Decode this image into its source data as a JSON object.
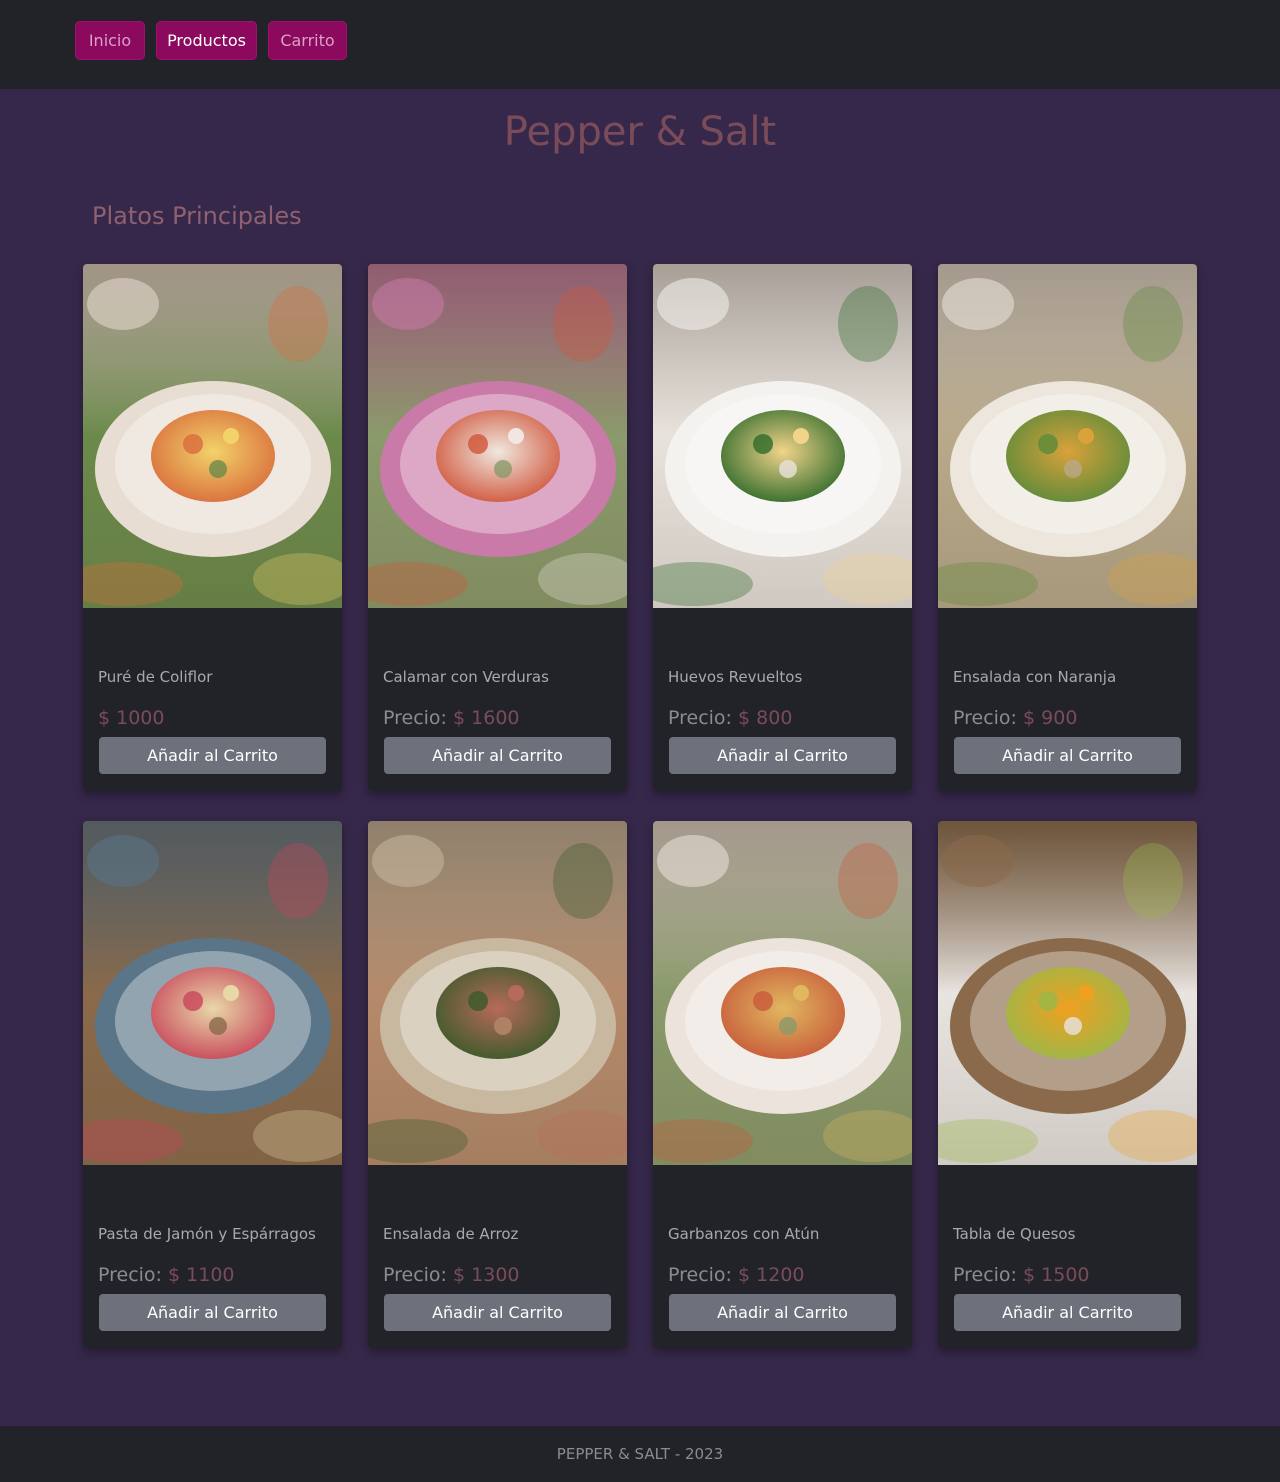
{
  "nav": {
    "items": [
      {
        "label": "Inicio",
        "active": false
      },
      {
        "label": "Productos",
        "active": true
      },
      {
        "label": "Carrito",
        "active": false
      }
    ]
  },
  "site_title": "Pepper & Salt",
  "section_title": "Platos Principales",
  "colors": {
    "nav_button": "#8b0a5e",
    "page_background": "#36284a",
    "card_background": "#212328",
    "price_accent": "#7a4c5a",
    "add_button": "#6c717b"
  },
  "products": [
    {
      "name": "Puré de Coliflor",
      "price_label": "",
      "price": "$ 1000",
      "button": "Añadir al Carrito",
      "image": "cauliflower-puree-photo",
      "palette": [
        "#6b8a4a",
        "#e8ddd2",
        "#f2d36a",
        "#d96c3c"
      ]
    },
    {
      "name": "Calamar con Verduras",
      "price_label": "Precio:",
      "price": "$ 1600",
      "button": "Añadir al Carrito",
      "image": "squid-with-vegetables-photo",
      "palette": [
        "#8a9a6a",
        "#c97aa8",
        "#f0e8e0",
        "#d0553a"
      ]
    },
    {
      "name": "Huevos Revueltos",
      "price_label": "Precio:",
      "price": "$ 800",
      "button": "Añadir al Carrito",
      "image": "scrambled-eggs-asparagus-photo",
      "palette": [
        "#e8e2dc",
        "#f4f2ef",
        "#f1d48a",
        "#2f6a2a"
      ]
    },
    {
      "name": "Ensalada con Naranja",
      "price_label": "Precio:",
      "price": "$ 900",
      "button": "Añadir al Carrito",
      "image": "orange-salad-photo",
      "palette": [
        "#b9a98a",
        "#ece6dc",
        "#d9a23a",
        "#5c8a3a"
      ]
    },
    {
      "name": "Pasta de Jamón y Espárragos",
      "price_label": "Precio:",
      "price": "$ 1100",
      "button": "Añadir al Carrito",
      "image": "ham-asparagus-pasta-photo",
      "palette": [
        "#8a6a4a",
        "#5a7488",
        "#e8d8a8",
        "#c8455a"
      ]
    },
    {
      "name": "Ensalada de Arroz",
      "price_label": "Precio:",
      "price": "$ 1300",
      "button": "Añadir al Carrito",
      "image": "rice-salad-photo",
      "palette": [
        "#b58a6a",
        "#c8b8a0",
        "#b86a5a",
        "#3a5a2a"
      ]
    },
    {
      "name": "Garbanzos con Atún",
      "price_label": "Precio:",
      "price": "$ 1200",
      "button": "Añadir al Carrito",
      "image": "chickpeas-tuna-photo",
      "palette": [
        "#8a9a6a",
        "#ece4dc",
        "#e0b860",
        "#c85a3a"
      ]
    },
    {
      "name": "Tabla de Quesos",
      "price_label": "Precio:",
      "price": "$ 1500",
      "button": "Añadir al Carrito",
      "image": "cheese-board-photo",
      "palette": [
        "#e8e4e0",
        "#8a6a4a",
        "#f0a020",
        "#9ab84a"
      ]
    }
  ],
  "footer": {
    "text": "PEPPER & SALT - 2023"
  }
}
